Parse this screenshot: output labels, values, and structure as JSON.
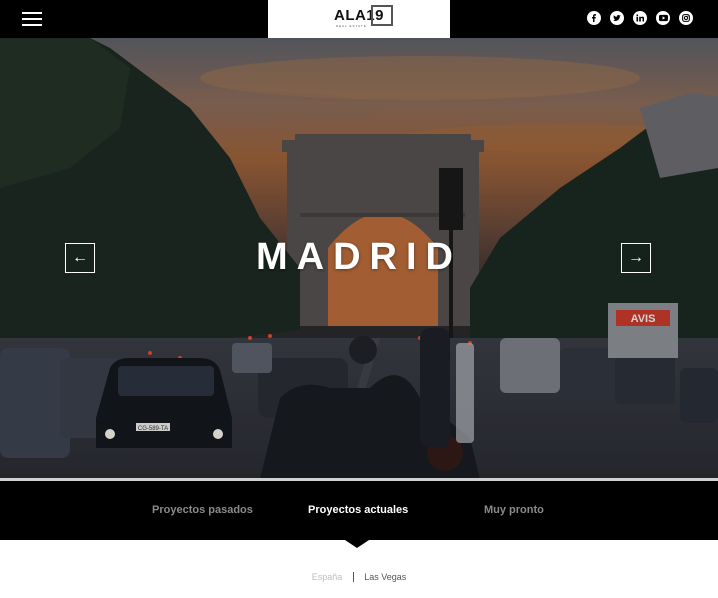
{
  "header": {
    "menu_icon": "hamburger-menu-icon",
    "logo": {
      "text": "ALA19",
      "subtitle": "REAL ESTATE"
    },
    "socials": [
      {
        "name": "facebook-icon"
      },
      {
        "name": "twitter-icon"
      },
      {
        "name": "linkedin-icon"
      },
      {
        "name": "youtube-icon"
      },
      {
        "name": "instagram-icon"
      }
    ]
  },
  "hero": {
    "title": "MADRID",
    "prev_arrow": "←",
    "next_arrow": "→",
    "sign_text": "AVIS",
    "plate_text": "CG-589-TA"
  },
  "tabs": {
    "items": [
      {
        "label": "Proyectos pasados",
        "active": false
      },
      {
        "label": "Proyectos actuales",
        "active": true
      },
      {
        "label": "Muy pronto",
        "active": false
      }
    ]
  },
  "subfilter": {
    "items": [
      {
        "label": "España",
        "active": false
      },
      {
        "label": "Las Vegas",
        "active": true
      }
    ]
  },
  "colors": {
    "topbar": "#000000",
    "tab_active": "#ffffff",
    "tab_inactive": "#8a8a8a"
  }
}
